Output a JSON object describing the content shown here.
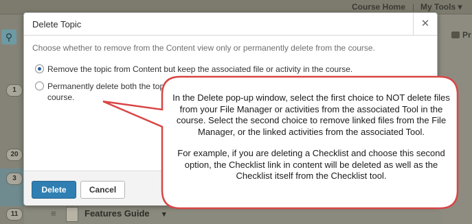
{
  "background": {
    "nav": {
      "course_home": "Course Home",
      "separator": "|",
      "my_tools": "My Tools ▾"
    },
    "right_label": "Pr",
    "badges": [
      "1",
      "20",
      "3",
      "11"
    ],
    "bottom_item": {
      "grip": "≡",
      "label": "Features Guide",
      "chevron": "▾"
    }
  },
  "dialog": {
    "title": "Delete Topic",
    "close_glyph": "✕",
    "description": "Choose whether to remove from the Content view only or permanently delete from the course.",
    "options": [
      {
        "label": "Remove the topic from Content but keep the associated file or activity in the course.",
        "checked": true
      },
      {
        "label": "Permanently delete both the topic f",
        "label_cont": "course.",
        "checked": false
      }
    ],
    "buttons": {
      "delete": "Delete",
      "cancel": "Cancel"
    }
  },
  "callout": {
    "paragraph1": "In the Delete pop-up window, select the first choice to NOT delete files from your File Manager or activities from the associated Tool in the course.  Select the second choice to remove linked files from the File Manager, or the linked activities from the associated Tool.",
    "paragraph2": "For example, if you are deleting a Checklist and choose this second option, the Checklist link in content will be deleted as well as the Checklist itself from the Checklist tool.",
    "border_color": "#d94545"
  },
  "colors": {
    "primary_button": "#2f7fb3",
    "radio_selected": "#2c5aa0"
  }
}
